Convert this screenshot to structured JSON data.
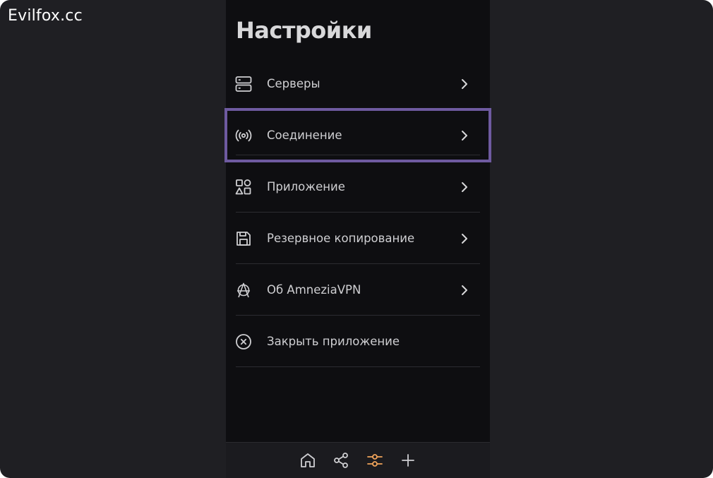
{
  "watermark": "Evilfox.cc",
  "page_title": "Настройки",
  "menu": {
    "items": [
      {
        "label": "Серверы",
        "icon": "servers-icon",
        "chevron": true
      },
      {
        "label": "Соединение",
        "icon": "connection-icon",
        "chevron": true,
        "selected": true
      },
      {
        "label": "Приложение",
        "icon": "application-icon",
        "chevron": true
      },
      {
        "label": "Резервное копирование",
        "icon": "backup-save-icon",
        "chevron": true
      },
      {
        "label": "Об AmneziaVPN",
        "icon": "amnezia-logo-icon",
        "chevron": true
      },
      {
        "label": "Закрыть приложение",
        "icon": "close-circle-icon",
        "chevron": false
      }
    ]
  },
  "tabbar": {
    "tabs": [
      {
        "name": "home",
        "icon": "home-icon",
        "active": false
      },
      {
        "name": "share",
        "icon": "share-icon",
        "active": false
      },
      {
        "name": "settings",
        "icon": "settings-sliders-icon",
        "active": true
      },
      {
        "name": "add",
        "icon": "plus-icon",
        "active": false
      }
    ]
  },
  "colors": {
    "background": "#1f1f23",
    "panel": "#0e0e11",
    "selection_outline": "#6e5aa0",
    "active_tab": "#f0a35a",
    "icon": "#cfcfd2"
  }
}
